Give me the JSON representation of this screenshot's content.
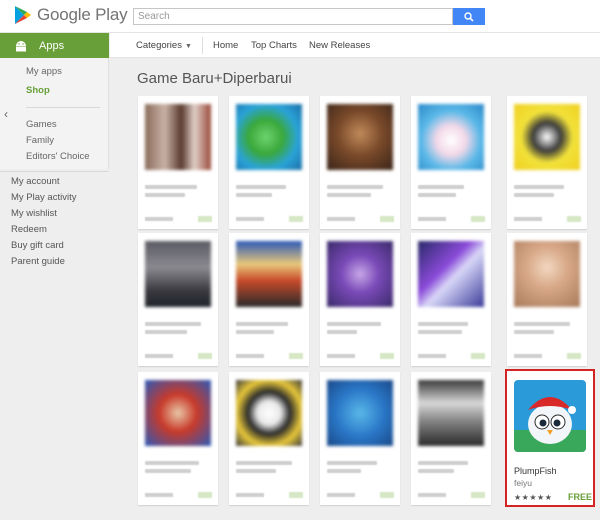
{
  "header": {
    "logo_text": "Google Play",
    "search_placeholder": "Search"
  },
  "sidebar": {
    "section_label": "Apps",
    "links": [
      {
        "label": "My apps"
      },
      {
        "label": "Shop"
      },
      {
        "label": "Games"
      },
      {
        "label": "Family"
      },
      {
        "label": "Editors' Choice"
      }
    ],
    "account_links": [
      {
        "label": "My account"
      },
      {
        "label": "My Play activity"
      },
      {
        "label": "My wishlist"
      },
      {
        "label": "Redeem"
      },
      {
        "label": "Buy gift card"
      },
      {
        "label": "Parent guide"
      }
    ]
  },
  "topnav": {
    "categories": "Categories",
    "home": "Home",
    "top_charts": "Top Charts",
    "new_releases": "New Releases"
  },
  "section": {
    "title": "Game Baru+Diperbarui"
  },
  "highlight_app": {
    "title": "PlumpFish",
    "developer": "feiyu",
    "stars": "★★★★★",
    "price": "FREE"
  },
  "colors": {
    "accent_green": "#689f38",
    "search_blue": "#4285f4",
    "highlight_red": "#d52323"
  },
  "icons": [
    "google-play-logo-icon",
    "search-icon",
    "android-icon",
    "chevron-left-icon",
    "chevron-down-icon"
  ]
}
